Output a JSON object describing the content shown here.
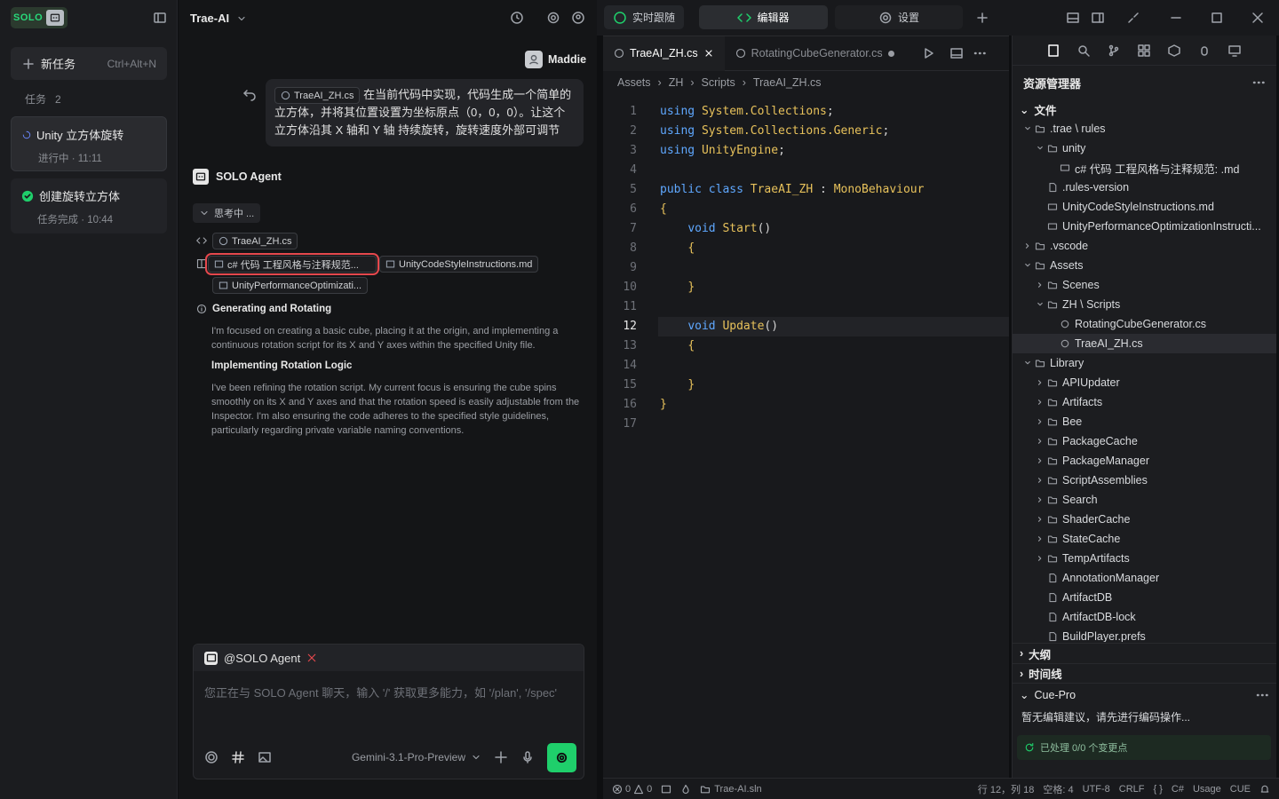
{
  "colors": {
    "accent": "#1fcf6b",
    "highlight": "#e5484d"
  },
  "left": {
    "logo": "SOLO",
    "new_task": "新任务",
    "new_task_shortcut": "Ctrl+Alt+N",
    "tasks_label": "任务",
    "tasks_count": "2",
    "tasks": [
      {
        "title": "Unity 立方体旋转",
        "status": "进行中 · 11:11"
      },
      {
        "title": "创建旋转立方体",
        "status": "任务完成 · 10:44"
      }
    ]
  },
  "chat": {
    "title": "Trae-AI",
    "user": "Maddie",
    "prompt_file": "TraeAI_ZH.cs",
    "prompt_text": "在当前代码中实现，代码生成一个简单的立方体，并将其位置设置为坐标原点（0，0，0）。让这个立方体沿其 X 轴和 Y 轴 持续旋转，旋转速度外部可调节",
    "agent": "SOLO Agent",
    "thinking": "思考中 ...",
    "files": [
      "TraeAI_ZH.cs",
      "c# 代码 工程风格与注释规范...",
      "UnityCodeStyleInstructions.md",
      "UnityPerformanceOptimizati..."
    ],
    "sec1_title": "Generating and Rotating",
    "sec1_text": "I'm focused on creating a basic cube, placing it at the origin, and implementing a continuous rotation script for its X and Y axes within the specified Unity file.",
    "sec2_title": "Implementing Rotation Logic",
    "sec2_text": "I've been refining the rotation script. My current focus is ensuring the cube spins smoothly on its X and Y axes and that the rotation speed is easily adjustable from the Inspector. I'm also ensuring the code adheres to the specified style guidelines, particularly regarding private variable naming conventions.",
    "input_agent": "@SOLO Agent",
    "input_placeholder": "您正在与 SOLO Agent 聊天，输入 '/' 获取更多能力，如 '/plan', '/spec'",
    "model": "Gemini-3.1-Pro-Preview"
  },
  "topbar": {
    "tab_live": "实时跟随",
    "tab_editor": "编辑器",
    "tab_settings": "设置"
  },
  "editor": {
    "tab1": "TraeAI_ZH.cs",
    "tab2": "RotatingCubeGenerator.cs",
    "crumbs": [
      "Assets",
      "ZH",
      "Scripts",
      "TraeAI_ZH.cs"
    ],
    "lines": [
      "using System.Collections;",
      "using System.Collections.Generic;",
      "using UnityEngine;",
      "",
      "public class TraeAI_ZH : MonoBehaviour",
      "{",
      "    void Start()",
      "    {",
      "",
      "    }",
      "",
      "    void Update()",
      "    {",
      "",
      "    }",
      "}",
      ""
    ]
  },
  "explorer": {
    "title": "资源管理器",
    "section": "文件",
    "items": [
      ".trae \\ rules",
      "unity",
      "c# 代码 工程风格与注释规范: .md",
      ".rules-version",
      "UnityCodeStyleInstructions.md",
      "UnityPerformanceOptimizationInstructi...",
      ".vscode",
      "Assets",
      "Scenes",
      "ZH \\ Scripts",
      "RotatingCubeGenerator.cs",
      "TraeAI_ZH.cs",
      "Library",
      "APIUpdater",
      "Artifacts",
      "Bee",
      "PackageCache",
      "PackageManager",
      "ScriptAssemblies",
      "Search",
      "ShaderCache",
      "StateCache",
      "TempArtifacts",
      "AnnotationManager",
      "ArtifactDB",
      "ArtifactDB-lock",
      "BuildPlayer.prefs"
    ],
    "outline": "大纲",
    "timeline": "时间线",
    "cue": "Cue-Pro",
    "cue_msg": "暂无编辑建议，请先进行编码操作...",
    "cue_status": "已处理 0/0 个变更点"
  },
  "status": {
    "errors": "0",
    "warnings": "0",
    "sln": "Trae-AI.sln",
    "pos": "行 12，列 18",
    "spaces": "空格: 4",
    "enc": "UTF-8",
    "eol": "CRLF",
    "braces": "{ }",
    "lang": "C#",
    "usage": "Usage",
    "cue": "CUE"
  }
}
